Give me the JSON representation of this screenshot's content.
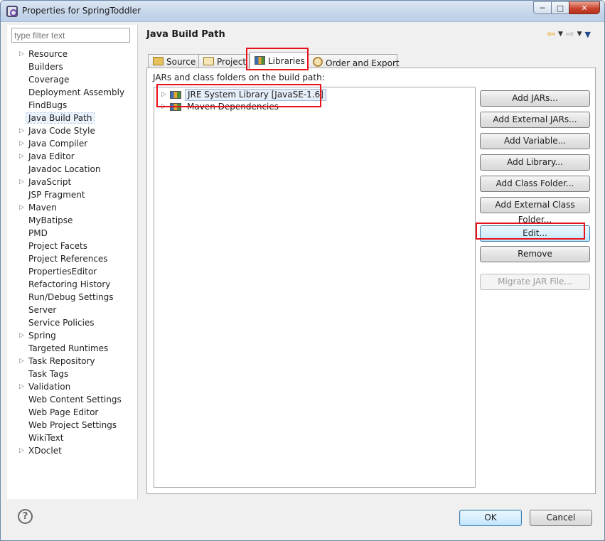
{
  "window": {
    "title": "Properties for SpringToddler"
  },
  "filter": {
    "placeholder": "type filter text"
  },
  "sidebar": {
    "items": [
      {
        "label": "Resource",
        "expandable": true
      },
      {
        "label": "Builders",
        "expandable": false
      },
      {
        "label": "Coverage",
        "expandable": false
      },
      {
        "label": "Deployment Assembly",
        "expandable": false
      },
      {
        "label": "FindBugs",
        "expandable": false
      },
      {
        "label": "Java Build Path",
        "expandable": false,
        "selected": true
      },
      {
        "label": "Java Code Style",
        "expandable": true
      },
      {
        "label": "Java Compiler",
        "expandable": true
      },
      {
        "label": "Java Editor",
        "expandable": true
      },
      {
        "label": "Javadoc Location",
        "expandable": false
      },
      {
        "label": "JavaScript",
        "expandable": true
      },
      {
        "label": "JSP Fragment",
        "expandable": false
      },
      {
        "label": "Maven",
        "expandable": true
      },
      {
        "label": "MyBatipse",
        "expandable": false
      },
      {
        "label": "PMD",
        "expandable": false
      },
      {
        "label": "Project Facets",
        "expandable": false
      },
      {
        "label": "Project References",
        "expandable": false
      },
      {
        "label": "PropertiesEditor",
        "expandable": false
      },
      {
        "label": "Refactoring History",
        "expandable": false
      },
      {
        "label": "Run/Debug Settings",
        "expandable": false
      },
      {
        "label": "Server",
        "expandable": false
      },
      {
        "label": "Service Policies",
        "expandable": false
      },
      {
        "label": "Spring",
        "expandable": true
      },
      {
        "label": "Targeted Runtimes",
        "expandable": false
      },
      {
        "label": "Task Repository",
        "expandable": true
      },
      {
        "label": "Task Tags",
        "expandable": false
      },
      {
        "label": "Validation",
        "expandable": true
      },
      {
        "label": "Web Content Settings",
        "expandable": false
      },
      {
        "label": "Web Page Editor",
        "expandable": false
      },
      {
        "label": "Web Project Settings",
        "expandable": false
      },
      {
        "label": "WikiText",
        "expandable": false
      },
      {
        "label": "XDoclet",
        "expandable": true
      }
    ]
  },
  "main": {
    "title": "Java Build Path",
    "tabs": [
      {
        "label": "Source",
        "icon": "folder-icon"
      },
      {
        "label": "Project",
        "icon": "folder-open-icon"
      },
      {
        "label": "Libraries",
        "icon": "library-icon",
        "active": true
      },
      {
        "label": "Order and Export",
        "icon": "order-icon"
      }
    ],
    "list_label": "JARs and class folders on the build path:",
    "libraries": [
      {
        "label": "JRE System Library [JavaSE-1.6]"
      },
      {
        "label": "Maven Dependencies"
      }
    ],
    "buttons": {
      "add_jars": "Add JARs...",
      "add_external_jars": "Add External JARs...",
      "add_variable": "Add Variable...",
      "add_library": "Add Library...",
      "add_class_folder": "Add Class Folder...",
      "add_external_class_folder": "Add External Class Folder...",
      "edit": "Edit...",
      "remove": "Remove",
      "migrate_jar": "Migrate JAR File..."
    }
  },
  "footer": {
    "help": "?",
    "ok": "OK",
    "cancel": "Cancel"
  },
  "colors": {
    "highlight": "#e8111b",
    "accent": "#3c7fb1"
  }
}
